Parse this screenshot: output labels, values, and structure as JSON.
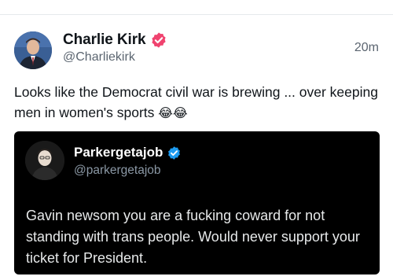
{
  "post": {
    "author_name": "Charlie Kirk",
    "handle": "@Charliekirk",
    "timestamp": "20m",
    "text": "Looks like the Democrat civil war is brewing ... over keeping men in women's sports",
    "emojis": "😂😂",
    "verified_badge_color": "#f0436f"
  },
  "quote": {
    "author_name": "Parkergetajob",
    "handle": "@parkergetajob",
    "text": "Gavin newsom you are a fucking coward for not standing with trans people. Would never support your ticket for President.",
    "verified_badge_color": "#1d9bf0",
    "background": "#000000"
  }
}
